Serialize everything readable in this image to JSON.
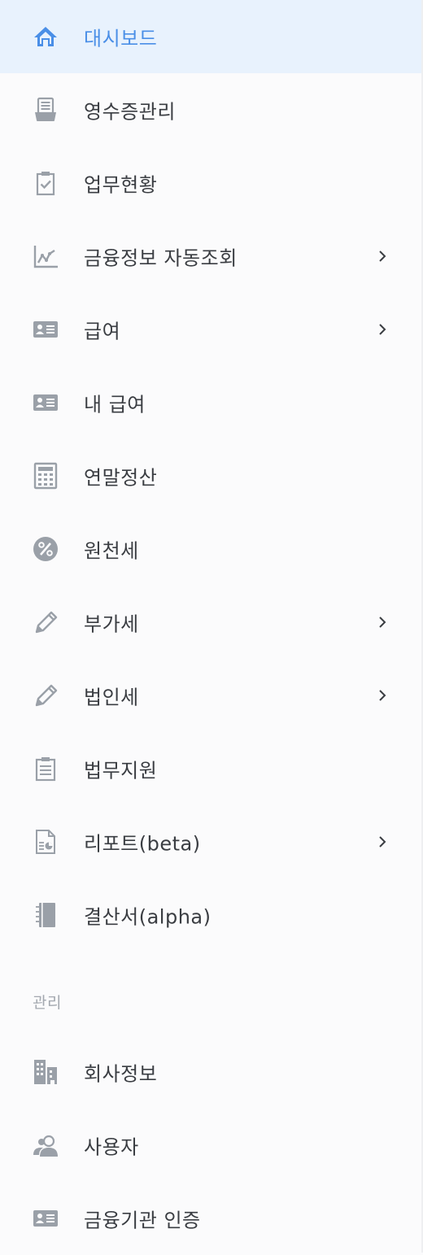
{
  "colors": {
    "active_text": "#4a8fe7",
    "active_bg": "#e8f2fd",
    "icon_gray": "#9aa0a8",
    "text": "#3a3d42",
    "section": "#a3a8af"
  },
  "menu": [
    {
      "label": "대시보드",
      "icon": "home-icon",
      "active": true,
      "has_submenu": false
    },
    {
      "label": "영수증관리",
      "icon": "receipt-icon",
      "active": false,
      "has_submenu": false
    },
    {
      "label": "업무현황",
      "icon": "clipboard-check-icon",
      "active": false,
      "has_submenu": false
    },
    {
      "label": "금융정보 자동조회",
      "icon": "line-chart-icon",
      "active": false,
      "has_submenu": true
    },
    {
      "label": "급여",
      "icon": "id-card-icon",
      "active": false,
      "has_submenu": true
    },
    {
      "label": "내 급여",
      "icon": "id-card-icon",
      "active": false,
      "has_submenu": false
    },
    {
      "label": "연말정산",
      "icon": "calculator-icon",
      "active": false,
      "has_submenu": false
    },
    {
      "label": "원천세",
      "icon": "percent-icon",
      "active": false,
      "has_submenu": false
    },
    {
      "label": "부가세",
      "icon": "pencil-icon",
      "active": false,
      "has_submenu": true
    },
    {
      "label": "법인세",
      "icon": "pencil-icon",
      "active": false,
      "has_submenu": true
    },
    {
      "label": "법무지원",
      "icon": "clipboard-list-icon",
      "active": false,
      "has_submenu": false
    },
    {
      "label": "리포트(beta)",
      "icon": "report-icon",
      "active": false,
      "has_submenu": true
    },
    {
      "label": "결산서(alpha)",
      "icon": "notebook-icon",
      "active": false,
      "has_submenu": false
    }
  ],
  "admin_section": {
    "title": "관리",
    "items": [
      {
        "label": "회사정보",
        "icon": "building-icon"
      },
      {
        "label": "사용자",
        "icon": "user-icon"
      },
      {
        "label": "금융기관 인증",
        "icon": "id-card-icon"
      }
    ]
  }
}
